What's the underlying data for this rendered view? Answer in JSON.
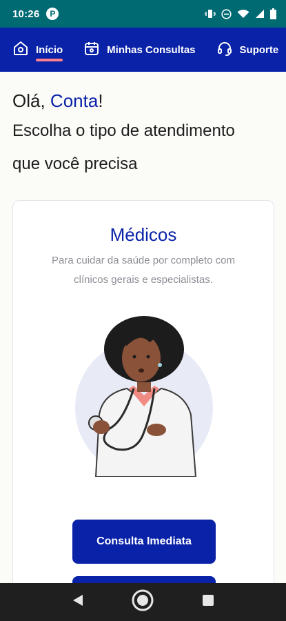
{
  "status_bar": {
    "time": "10:26",
    "badge": "P",
    "icons": [
      "vibrate-icon",
      "do-not-disturb-icon",
      "wifi-icon",
      "signal-icon",
      "battery-icon"
    ]
  },
  "nav": {
    "items": [
      {
        "label": "Início",
        "icon": "home-icon",
        "active": true
      },
      {
        "label": "Minhas Consultas",
        "icon": "calendar-icon",
        "active": false
      },
      {
        "label": "Suporte",
        "icon": "headset-icon",
        "active": false
      }
    ]
  },
  "greeting": {
    "hello": "Olá,",
    "name": "Conta",
    "exclamation": "!",
    "subtitle_line1": "Escolha o tipo de atendimento",
    "subtitle_line2": "que você precisa"
  },
  "card": {
    "title": "Médicos",
    "description": "Para cuidar da saúde por completo com clínicos gerais e especialistas.",
    "primary_button": "Consulta Imediata",
    "secondary_button": ""
  },
  "system_nav": {
    "icons": [
      "back-icon",
      "home-circle-icon",
      "recents-icon"
    ]
  },
  "colors": {
    "status_bar": "#006a73",
    "brand": "#0a22a8",
    "accent": "#ff7f8a"
  }
}
